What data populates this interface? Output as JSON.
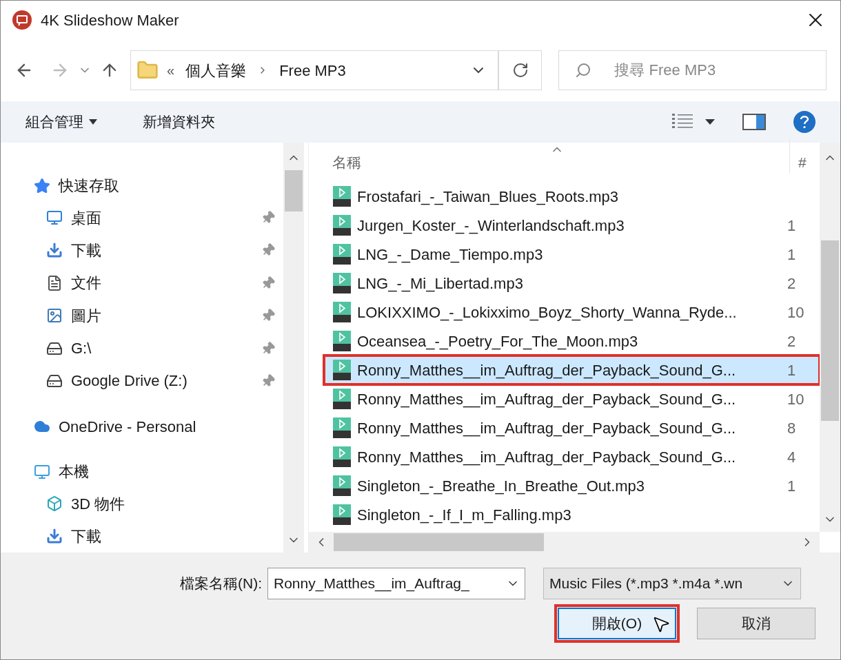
{
  "window": {
    "title": "4K Slideshow Maker"
  },
  "address_bar": {
    "overflow": "«",
    "path": [
      {
        "label": "個人音樂"
      },
      {
        "label": "Free MP3"
      }
    ]
  },
  "search": {
    "placeholder": "搜尋 Free MP3"
  },
  "toolbar": {
    "organize": "組合管理",
    "new_folder": "新增資料夾"
  },
  "sidebar": {
    "items": [
      {
        "label": "快速存取",
        "kind": "star",
        "children": [
          {
            "label": "桌面",
            "kind": "desktop",
            "pinned": true
          },
          {
            "label": "下載",
            "kind": "download",
            "pinned": true
          },
          {
            "label": "文件",
            "kind": "document",
            "pinned": true
          },
          {
            "label": "圖片",
            "kind": "picture",
            "pinned": true
          },
          {
            "label": "G:\\",
            "kind": "drive",
            "pinned": true
          },
          {
            "label": "Google Drive (Z:)",
            "kind": "drive",
            "pinned": true
          }
        ]
      },
      {
        "label": "OneDrive - Personal",
        "kind": "cloud"
      },
      {
        "label": "本機",
        "kind": "computer",
        "children": [
          {
            "label": "3D 物件",
            "kind": "cube",
            "pinned": false
          },
          {
            "label": "下載",
            "kind": "download",
            "pinned": false
          }
        ]
      }
    ]
  },
  "file_list": {
    "columns": [
      "名稱",
      "#"
    ],
    "rows": [
      {
        "name": "Frostafari_-_Taiwan_Blues_Roots.mp3",
        "selected": false,
        "highlighted": false
      },
      {
        "name": "Jurgen_Koster_-_Winterlandschaft.mp3",
        "number": "1",
        "selected": false,
        "highlighted": false
      },
      {
        "name": "LNG_-_Dame_Tiempo.mp3",
        "number": "1",
        "selected": false,
        "highlighted": false
      },
      {
        "name": "LNG_-_Mi_Libertad.mp3",
        "number": "2",
        "selected": false,
        "highlighted": false
      },
      {
        "name": "LOKIXXIMO_-_Lokixximo_Boyz_Shorty_Wanna_Ryde...",
        "number": "10",
        "selected": false,
        "highlighted": false
      },
      {
        "name": "Oceansea_-_Poetry_For_The_Moon.mp3",
        "number": "2",
        "selected": false,
        "highlighted": false
      },
      {
        "name": "Ronny_Matthes__im_Auftrag_der_Payback_Sound_G...",
        "number": "1",
        "selected": true,
        "highlighted": true
      },
      {
        "name": "Ronny_Matthes__im_Auftrag_der_Payback_Sound_G...",
        "number": "10",
        "selected": false,
        "highlighted": false
      },
      {
        "name": "Ronny_Matthes__im_Auftrag_der_Payback_Sound_G...",
        "number": "8",
        "selected": false,
        "highlighted": false
      },
      {
        "name": "Ronny_Matthes__im_Auftrag_der_Payback_Sound_G...",
        "number": "4",
        "selected": false,
        "highlighted": false
      },
      {
        "name": "Singleton_-_Breathe_In_Breathe_Out.mp3",
        "number": "1",
        "selected": false,
        "highlighted": false
      },
      {
        "name": "Singleton_-_If_I_m_Falling.mp3",
        "selected": false,
        "highlighted": false
      }
    ]
  },
  "file_name": {
    "label": "檔案名稱(N):",
    "value": "Ronny_Matthes__im_Auftrag_"
  },
  "file_type": {
    "value": "Music Files (*.mp3 *.m4a *.wn"
  },
  "buttons": [
    {
      "label": "開啟(O)",
      "kind": "primary",
      "highlighted": true
    },
    {
      "label": "取消",
      "kind": "cancel",
      "highlighted": false
    }
  ]
}
